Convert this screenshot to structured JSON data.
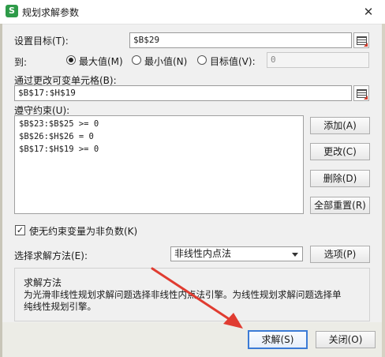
{
  "window": {
    "title": "规划求解参数",
    "app_icon_glyph": "S",
    "close_glyph": "✕"
  },
  "objective": {
    "label": "设置目标(T):",
    "value": "$B$29"
  },
  "to": {
    "label": "到:",
    "options": [
      {
        "label": "最大值(M)",
        "selected": true
      },
      {
        "label": "最小值(N)",
        "selected": false
      },
      {
        "label": "目标值(V):",
        "selected": false
      }
    ],
    "target_value": "0"
  },
  "variables": {
    "label": "通过更改可变单元格(B):",
    "value": "$B$17:$H$19"
  },
  "constraints": {
    "label": "遵守约束(U):",
    "items": [
      "$B$23:$B$25 >= 0",
      "$B$26:$H$26 = 0",
      "$B$17:$H$19 >= 0"
    ],
    "add_label": "添加(A)",
    "change_label": "更改(C)",
    "delete_label": "删除(D)",
    "reset_label": "全部重置(R)"
  },
  "nonneg": {
    "label": "使无约束变量为非负数(K)",
    "checked": true,
    "mark": "✓"
  },
  "method": {
    "label": "选择求解方法(E):",
    "selected": "非线性内点法",
    "options_label": "选项(P)"
  },
  "description": {
    "title": "求解方法",
    "text_line1": "为光滑非线性规划求解问题选择非线性内点法引擎。为线性规划求解问题选择单",
    "text_line2": "纯线性规划引擎。"
  },
  "footer": {
    "solve_label": "求解(S)",
    "close_label": "关闭(O)"
  },
  "colors": {
    "annotation_arrow": "#e03c31",
    "primary_border": "#3b7bd6",
    "app_icon": "#2e9b49"
  }
}
